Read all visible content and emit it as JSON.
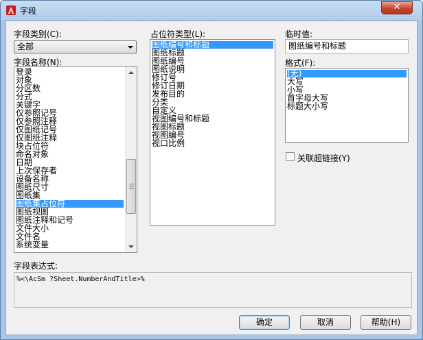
{
  "window": {
    "title": "字段",
    "close_glyph": "✕"
  },
  "field_category": {
    "label": "字段类别(C):",
    "selected": "全部"
  },
  "field_names": {
    "label": "字段名称(N):",
    "items": [
      "登录",
      "对象",
      "分区数",
      "分式",
      "关键字",
      "仅参照记号",
      "仅参照注释",
      "仅图纸记号",
      "仅图纸注释",
      "块占位符",
      "命名对象",
      "日期",
      "上次保存者",
      "设备名称",
      "图纸尺寸",
      "图纸集",
      "图纸集占位符",
      "图纸视图",
      "图纸注释和记号",
      "文件大小",
      "文件名",
      "系统变量"
    ],
    "selected_index": 16
  },
  "placeholder_type": {
    "label": "占位符类型(L):",
    "items": [
      "图纸编号和标题",
      "图纸标题",
      "图纸编号",
      "图纸说明",
      "修订号",
      "修订日期",
      "发布目的",
      "分类",
      "自定义",
      "视图编号和标题",
      "视图标题",
      "视图编号",
      "视口比例"
    ],
    "selected_index": 0
  },
  "temp_value": {
    "label": "临时值:",
    "value": "图纸编号和标题"
  },
  "format": {
    "label": "格式(F):",
    "items": [
      "(无)",
      "大写",
      "小写",
      "首字母大写",
      "标题大小写"
    ],
    "selected_index": 0
  },
  "hyperlink": {
    "label": "关联超链接(Y)"
  },
  "expression": {
    "label": "字段表达式:",
    "value": "%<\\AcSm ?Sheet.NumberAndTitle>%"
  },
  "buttons": {
    "ok": "确定",
    "cancel": "取消",
    "help": "帮助(H)"
  },
  "colors": {
    "selection": "#3399ff",
    "title_bar": "#b9d1ea",
    "close": "#c7432e"
  }
}
